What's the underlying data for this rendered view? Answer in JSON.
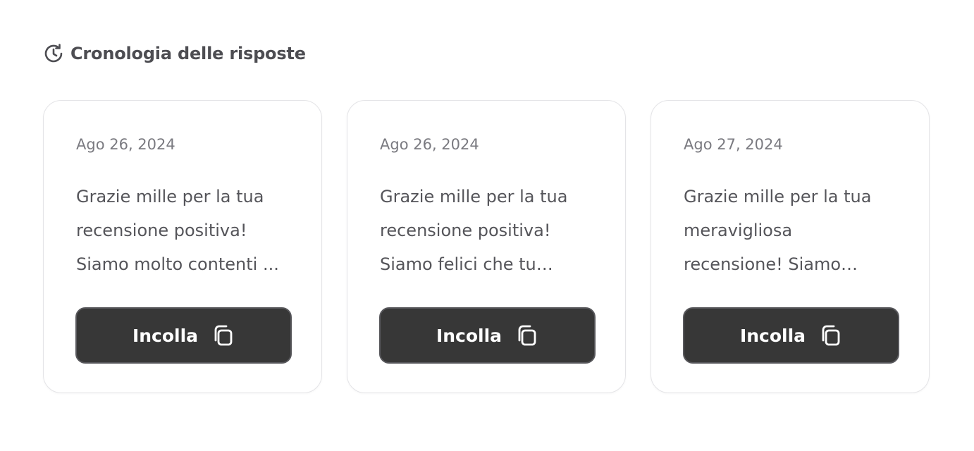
{
  "header": {
    "icon": "history-icon",
    "title": "Cronologia delle risposte"
  },
  "cards": [
    {
      "date": "Ago 26, 2024",
      "text": "Grazie mille per la tua recensione positiva! Siamo molto contenti ...",
      "button_label": "Incolla",
      "button_icon": "copy-icon"
    },
    {
      "date": "Ago 26, 2024",
      "text": "Grazie mille per la tua recensione positiva! Siamo felici che tu abbi...",
      "button_label": "Incolla",
      "button_icon": "copy-icon"
    },
    {
      "date": "Ago 27, 2024",
      "text": "Grazie mille per la tua meravigliosa recensione! Siamo felic...",
      "button_label": "Incolla",
      "button_icon": "copy-icon"
    }
  ],
  "colors": {
    "button_bg": "#373737",
    "text": "#55555a",
    "date": "#7a7a80",
    "card_border": "#e4e4e7"
  }
}
